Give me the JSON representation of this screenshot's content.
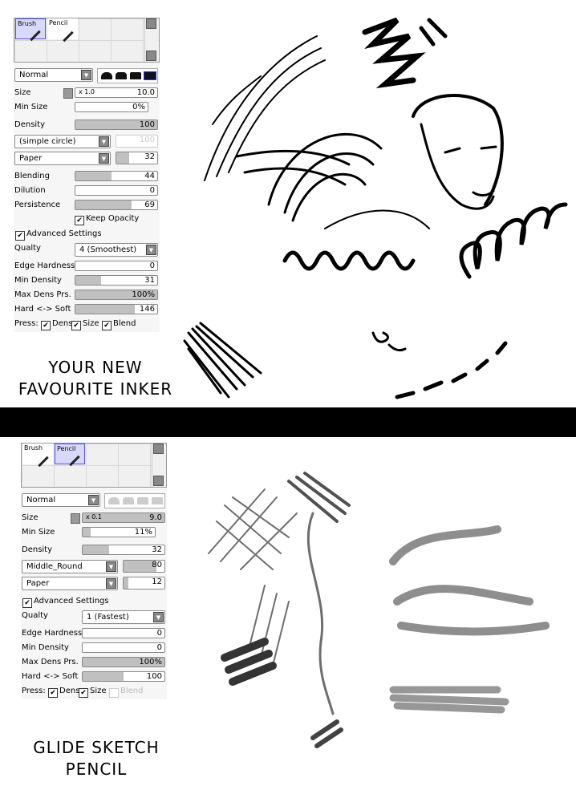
{
  "panels": [
    {
      "tools": [
        {
          "label": "Brush",
          "selected": true
        },
        {
          "label": "Pencil",
          "selected": false
        }
      ],
      "blend_mode": "Normal",
      "shape_selected": 4,
      "shapes_enabled": true,
      "size": {
        "label": "Size",
        "multiplier": "x 1.0",
        "value": "10.0",
        "fill": 0
      },
      "min_size": {
        "label": "Min Size",
        "value": "0%",
        "fill": 0
      },
      "density": {
        "label": "Density",
        "value": "100",
        "fill": 1
      },
      "brush_shape": {
        "value": "(simple circle)",
        "amount": "100",
        "fill": 0,
        "disabled": true
      },
      "texture": {
        "value": "Paper",
        "amount": "32",
        "fill": 0.32
      },
      "blending": {
        "label": "Blending",
        "value": "44",
        "fill": 0.44
      },
      "dilution": {
        "label": "Dilution",
        "value": "0",
        "fill": 0
      },
      "persistence": {
        "label": "Persistence",
        "value": "69",
        "fill": 0.69
      },
      "keep_opacity": {
        "label": "Keep Opacity",
        "checked": true
      },
      "advanced": {
        "label": "Advanced Settings",
        "checked": true
      },
      "quality": {
        "label": "Qualty",
        "value": "4 (Smoothest)"
      },
      "edge_hardness": {
        "label": "Edge Hardness",
        "value": "0",
        "fill": 0
      },
      "min_density": {
        "label": "Min Density",
        "value": "31",
        "fill": 0.31
      },
      "max_dens_prs": {
        "label": "Max Dens Prs.",
        "value": "100%",
        "fill": 1
      },
      "hard_soft": {
        "label": "Hard <-> Soft",
        "value": "146",
        "fill": 0.73
      },
      "press": {
        "label": "Press:",
        "options": [
          {
            "label": "Dens",
            "checked": true
          },
          {
            "label": "Size",
            "checked": true
          },
          {
            "label": "Blend",
            "checked": true
          }
        ]
      }
    },
    {
      "tools": [
        {
          "label": "Brush",
          "selected": false
        },
        {
          "label": "Pencil",
          "selected": true
        }
      ],
      "blend_mode": "Normal",
      "shape_selected": 0,
      "shapes_enabled": false,
      "size": {
        "label": "Size",
        "multiplier": "x 0.1",
        "value": "9.0",
        "fill": 1
      },
      "min_size": {
        "label": "Min Size",
        "value": "11%",
        "fill": 0.11
      },
      "density": {
        "label": "Density",
        "value": "32",
        "fill": 0.32
      },
      "brush_shape": {
        "value": "Middle_Round",
        "amount": "80",
        "fill": 0.8,
        "disabled": false
      },
      "texture": {
        "value": "Paper",
        "amount": "12",
        "fill": 0.12
      },
      "advanced": {
        "label": "Advanced Settings",
        "checked": true
      },
      "quality": {
        "label": "Qualty",
        "value": "1 (Fastest)"
      },
      "edge_hardness": {
        "label": "Edge Hardness",
        "value": "0",
        "fill": 0
      },
      "min_density": {
        "label": "Min Density",
        "value": "0",
        "fill": 0
      },
      "max_dens_prs": {
        "label": "Max Dens Prs.",
        "value": "100%",
        "fill": 1
      },
      "hard_soft": {
        "label": "Hard <-> Soft",
        "value": "100",
        "fill": 0.5
      },
      "press": {
        "label": "Press:",
        "options": [
          {
            "label": "Dens",
            "checked": true
          },
          {
            "label": "Size",
            "checked": true
          },
          {
            "label": "Blend",
            "checked": false
          }
        ]
      }
    }
  ],
  "captions": [
    {
      "line1": "YOUR NEW",
      "line2": "FAVOURITE INKER"
    },
    {
      "line1": "GLIDE SKETCH",
      "line2": "PENCIL"
    }
  ]
}
